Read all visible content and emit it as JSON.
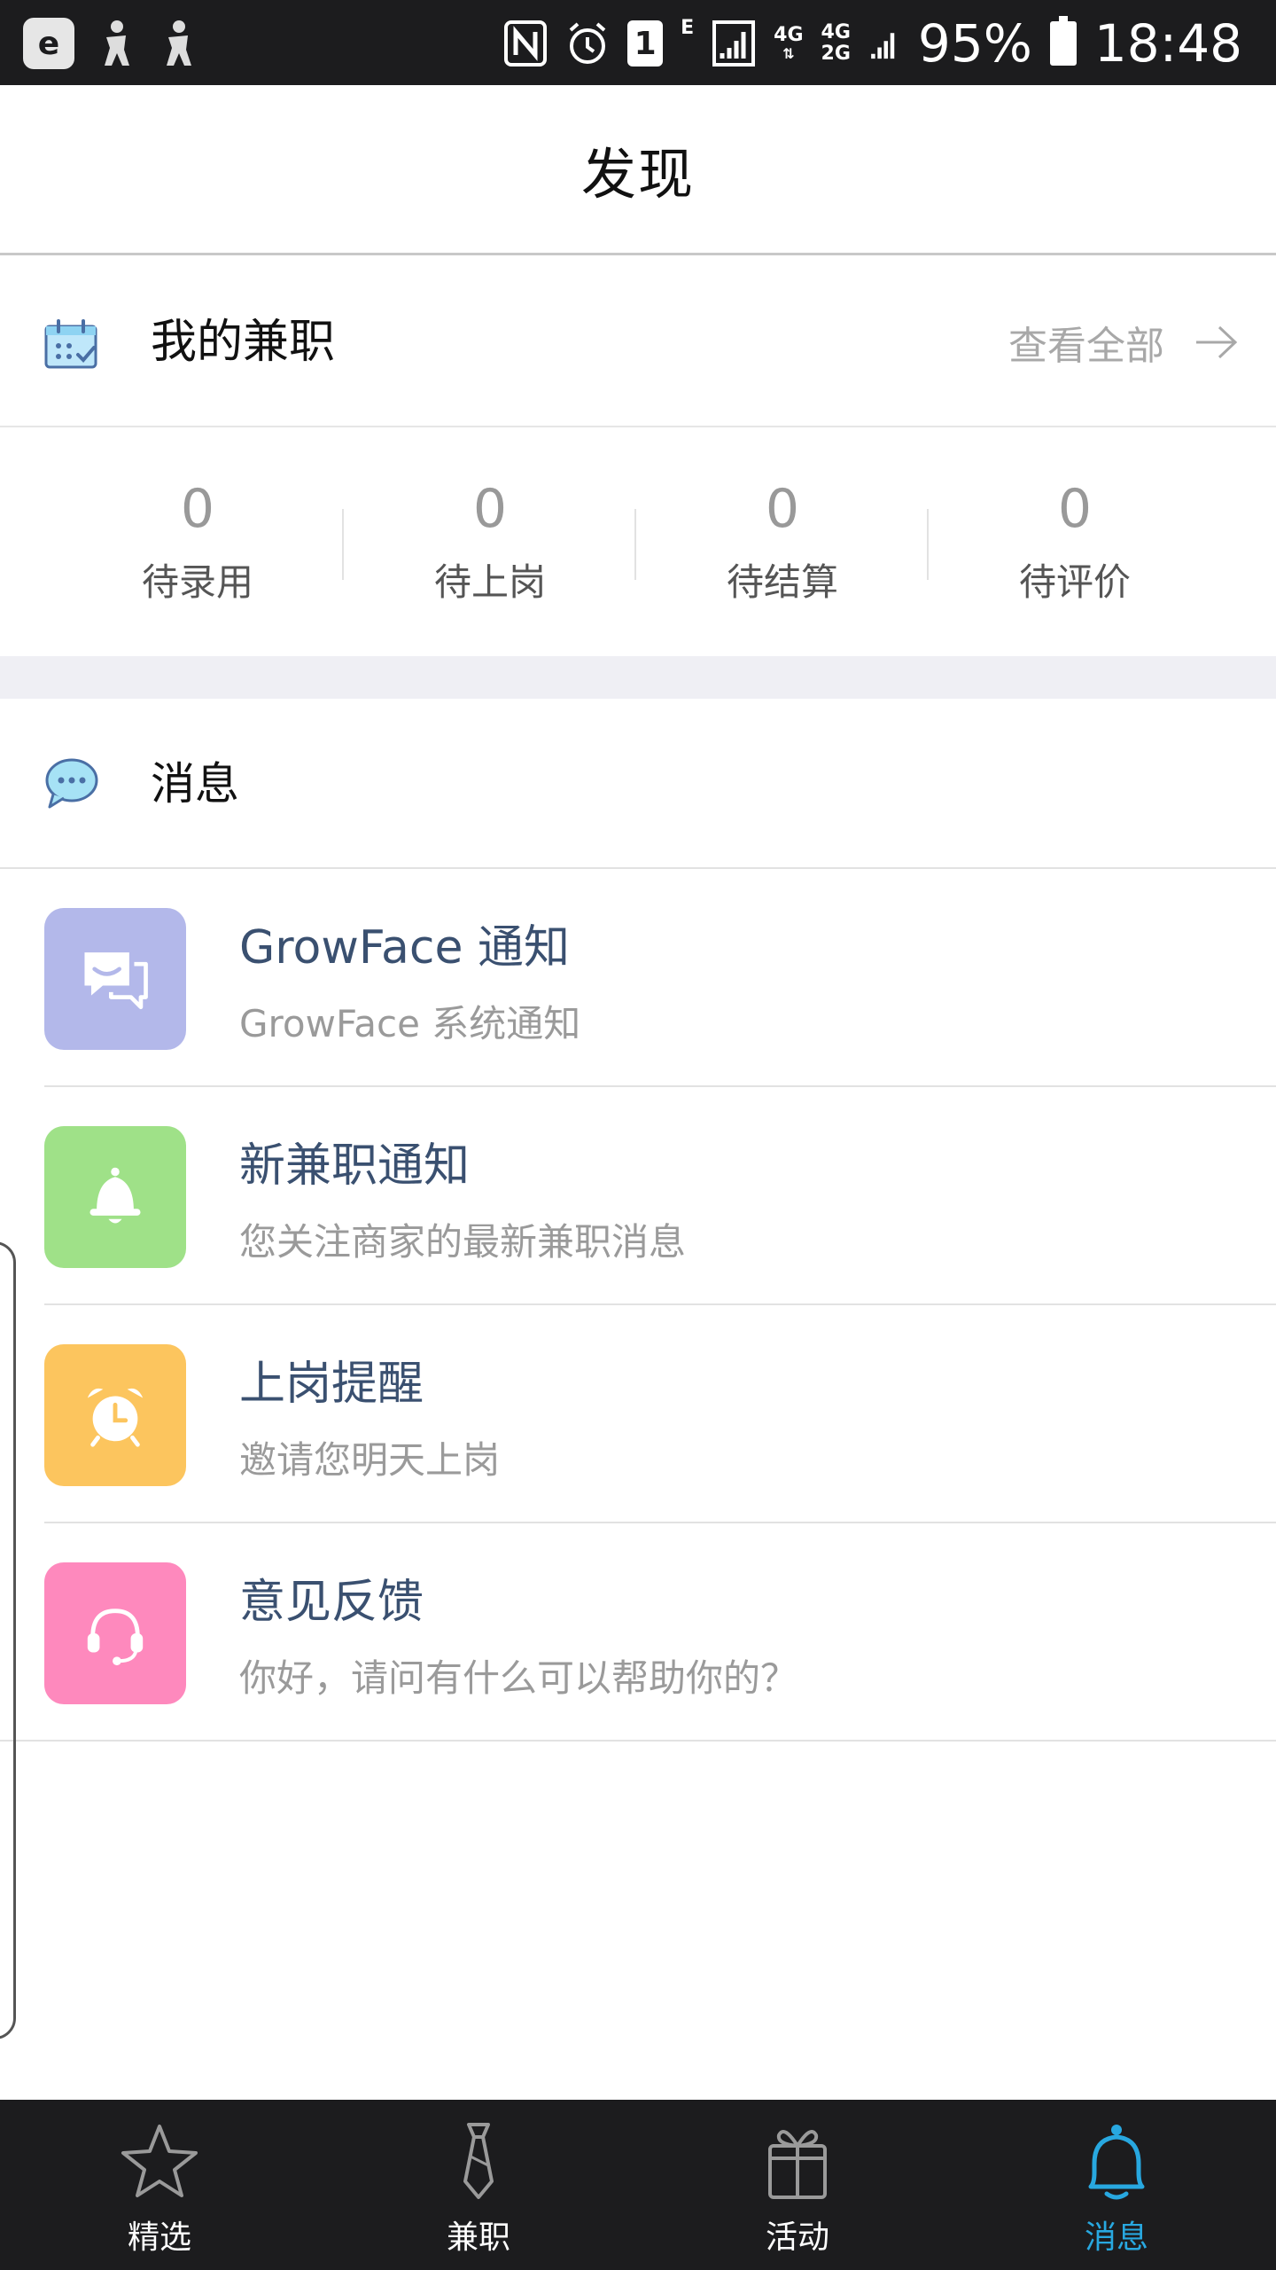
{
  "status_bar": {
    "signal_4g_label": "4G",
    "signal_2g_top": "4G",
    "signal_2g_bottom": "2G",
    "e_label": "E",
    "sim_label": "1",
    "battery": "95%",
    "time": "18:48"
  },
  "header": {
    "title": "发现"
  },
  "my_jobs": {
    "label": "我的兼职",
    "view_all": "查看全部",
    "stats": [
      {
        "value": "0",
        "label": "待录用"
      },
      {
        "value": "0",
        "label": "待上岗"
      },
      {
        "value": "0",
        "label": "待结算"
      },
      {
        "value": "0",
        "label": "待评价"
      }
    ]
  },
  "messages": {
    "label": "消息",
    "items": [
      {
        "title": "GrowFace 通知",
        "subtitle": "GrowFace 系统通知",
        "icon": "chat-smile-icon",
        "color": "#b3b8ea"
      },
      {
        "title": "新兼职通知",
        "subtitle": "您关注商家的最新兼职消息",
        "icon": "bell-icon",
        "color": "#9fe188"
      },
      {
        "title": "上岗提醒",
        "subtitle": "邀请您明天上岗",
        "icon": "alarm-clock-icon",
        "color": "#fcc55e"
      },
      {
        "title": "意见反馈",
        "subtitle": "你好，请问有什么可以帮助你的？",
        "icon": "headset-icon",
        "color": "#fe89bd"
      }
    ]
  },
  "tab_bar": {
    "tabs": [
      {
        "label": "精选",
        "icon": "star-icon"
      },
      {
        "label": "兼职",
        "icon": "tie-icon"
      },
      {
        "label": "活动",
        "icon": "gift-icon"
      },
      {
        "label": "消息",
        "icon": "bell-icon",
        "active": true
      }
    ],
    "active_color": "#28a8e0"
  }
}
